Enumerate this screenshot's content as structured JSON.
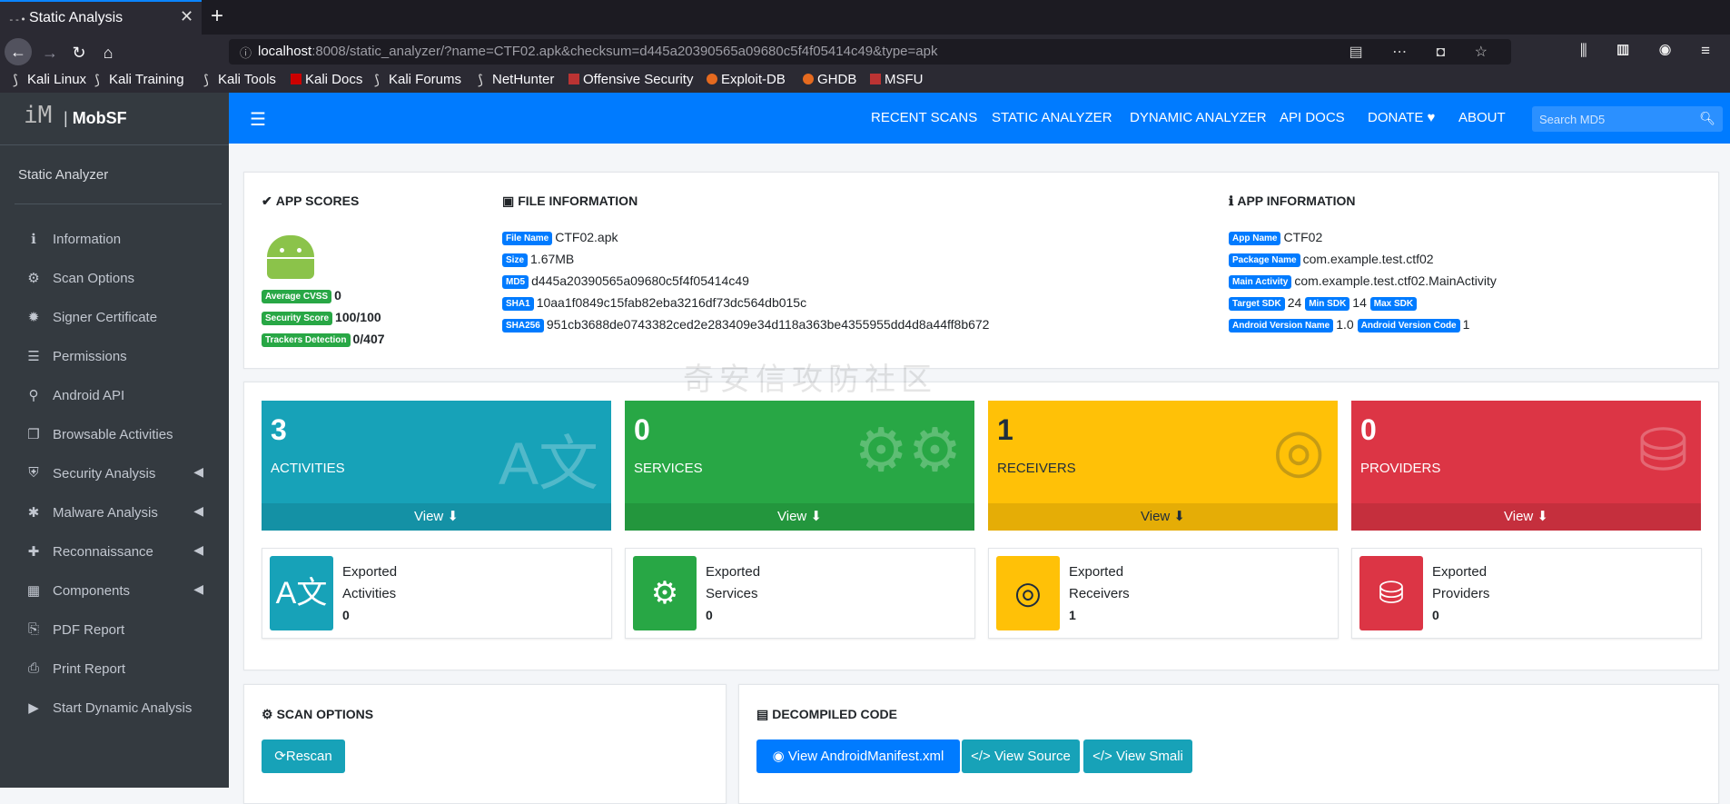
{
  "browser": {
    "tab_title": "Static Analysis",
    "tab_icon": "--•",
    "close": "✕",
    "newtab": "+",
    "url_host": "localhost",
    "url_rest": ":8008/static_analyzer/?name=CTF02.apk&checksum=d445a20390565a09680c5f4f05414c49&type=apk",
    "bookmarks": [
      "Kali Linux",
      "Kali Training",
      "Kali Tools",
      "Kali Docs",
      "Kali Forums",
      "NetHunter",
      "Offensive Security",
      "Exploit-DB",
      "GHDB",
      "MSFU"
    ]
  },
  "sidebar": {
    "brand_logo": "iM",
    "brand_prefix": "| ",
    "brand_name": "MobSF",
    "title": "Static Analyzer",
    "items": [
      {
        "label": "Information",
        "icon": "info-circle-icon"
      },
      {
        "label": "Scan Options",
        "icon": "cog-icon"
      },
      {
        "label": "Signer Certificate",
        "icon": "certificate-icon"
      },
      {
        "label": "Permissions",
        "icon": "list-icon"
      },
      {
        "label": "Android API",
        "icon": "android-icon"
      },
      {
        "label": "Browsable Activities",
        "icon": "clone-icon"
      },
      {
        "label": "Security Analysis",
        "icon": "shield-icon"
      },
      {
        "label": "Malware Analysis",
        "icon": "bug-icon"
      },
      {
        "label": "Reconnaissance",
        "icon": "plus-icon"
      },
      {
        "label": "Components",
        "icon": "th-large-icon"
      },
      {
        "label": "PDF Report",
        "icon": "file-pdf-icon"
      },
      {
        "label": "Print Report",
        "icon": "print-icon"
      },
      {
        "label": "Start Dynamic Analysis",
        "icon": "play-circle-icon"
      }
    ]
  },
  "topnav": {
    "links": [
      "RECENT SCANS",
      "STATIC ANALYZER",
      "DYNAMIC ANALYZER",
      "API DOCS",
      "DONATE ♥",
      "ABOUT"
    ],
    "search_placeholder": "Search MD5"
  },
  "app_scores": {
    "heading": "APP SCORES",
    "avg_cvss_label": "Average CVSS",
    "avg_cvss": "0",
    "security_score_label": "Security Score",
    "security_score": "100/100",
    "trackers_label": "Trackers Detection",
    "trackers": "0/407"
  },
  "file_info": {
    "heading": "FILE INFORMATION",
    "file_name_label": "File Name",
    "file_name": "CTF02.apk",
    "size_label": "Size",
    "size": "1.67MB",
    "md5_label": "MD5",
    "md5": "d445a20390565a09680c5f4f05414c49",
    "sha1_label": "SHA1",
    "sha1": "10aa1f0849c15fab82eba3216df73dc564db015c",
    "sha256_label": "SHA256",
    "sha256": "951cb3688de0743382ced2e283409e34d118a363be4355955dd4d8a44ff8b672"
  },
  "app_info": {
    "heading": "APP INFORMATION",
    "app_name_label": "App Name",
    "app_name": "CTF02",
    "package_label": "Package Name",
    "package": "com.example.test.ctf02",
    "main_activity_label": "Main Activity",
    "main_activity": "com.example.test.ctf02.MainActivity",
    "target_sdk_label": "Target SDK",
    "target_sdk": "24",
    "min_sdk_label": "Min SDK",
    "min_sdk": "14",
    "max_sdk_label": "Max SDK",
    "max_sdk": "",
    "version_name_label": "Android Version Name",
    "version_name": "1.0",
    "version_code_label": "Android Version Code",
    "version_code": "1"
  },
  "components": [
    {
      "count": "3",
      "label": "ACTIVITIES",
      "view": "View",
      "color": "#17a2b8",
      "icon": "language-icon",
      "exported_line1": "Exported",
      "exported_line2": "Activities",
      "exported_count": "0"
    },
    {
      "count": "0",
      "label": "SERVICES",
      "view": "View",
      "color": "#28a745",
      "icon": "cogs-icon",
      "exported_line1": "Exported",
      "exported_line2": "Services",
      "exported_count": "0"
    },
    {
      "count": "1",
      "label": "RECEIVERS",
      "view": "View",
      "color": "#ffc107",
      "icon": "assistive-listening-icon",
      "exported_line1": "Exported",
      "exported_line2": "Receivers",
      "exported_count": "1"
    },
    {
      "count": "0",
      "label": "PROVIDERS",
      "view": "View",
      "color": "#dc3545",
      "icon": "database-icon",
      "exported_line1": "Exported",
      "exported_line2": "Providers",
      "exported_count": "0"
    }
  ],
  "scan_options": {
    "heading": "SCAN OPTIONS",
    "rescan": "Rescan"
  },
  "decompiled": {
    "heading": "DECOMPILED CODE",
    "manifest": "View AndroidManifest.xml",
    "source": "View Source",
    "smali": "View Smali"
  },
  "watermark": "奇安信攻防社区"
}
